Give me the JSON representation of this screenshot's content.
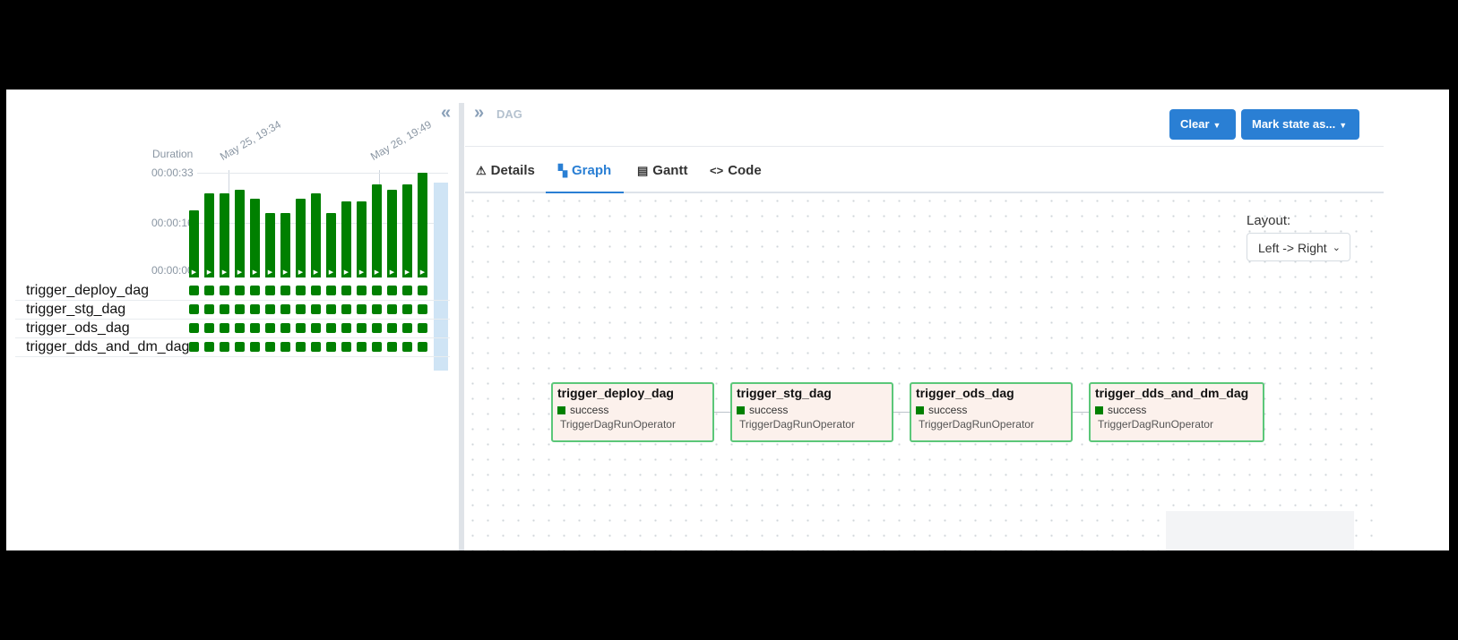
{
  "left_panel": {
    "collapse_icon": "double-chevron-left-icon",
    "duration_label": "Duration",
    "y_ticks": [
      "00:00:33",
      "00:00:16",
      "00:00:00"
    ],
    "date_labels": [
      "May 25, 19:34",
      "May 26, 19:49"
    ],
    "run_durations_sec": [
      20,
      26,
      26,
      27,
      24,
      19,
      19,
      24,
      26,
      19,
      23,
      23,
      29,
      27,
      29,
      33
    ],
    "run_state": "success",
    "tasks": [
      {
        "name": "trigger_deploy_dag"
      },
      {
        "name": "trigger_stg_dag"
      },
      {
        "name": "trigger_ods_dag"
      },
      {
        "name": "trigger_dds_and_dm_dag"
      }
    ]
  },
  "right_panel": {
    "expand_icon": "double-chevron-right-icon",
    "breadcrumb": "DAG",
    "buttons": {
      "clear_label": "Clear",
      "mark_state_label": "Mark state as..."
    },
    "tabs": [
      {
        "label": "Details",
        "icon": "warning-triangle-icon",
        "glyph": "⚠"
      },
      {
        "label": "Graph",
        "icon": "graph-icon",
        "glyph": "▚"
      },
      {
        "label": "Gantt",
        "icon": "gantt-icon",
        "glyph": "▤"
      },
      {
        "label": "Code",
        "icon": "code-icon",
        "glyph": "<>"
      }
    ],
    "active_tab": "Graph",
    "layout": {
      "label": "Layout:",
      "value": "Left -> Right"
    },
    "nodes": [
      {
        "title": "trigger_deploy_dag",
        "status": "success",
        "operator": "TriggerDagRunOperator"
      },
      {
        "title": "trigger_stg_dag",
        "status": "success",
        "operator": "TriggerDagRunOperator"
      },
      {
        "title": "trigger_ods_dag",
        "status": "success",
        "operator": "TriggerDagRunOperator"
      },
      {
        "title": "trigger_dds_and_dm_dag",
        "status": "success",
        "operator": "TriggerDagRunOperator"
      }
    ]
  },
  "colors": {
    "success": "#008000",
    "accent": "#2a7fd4",
    "node_fill": "#fcf1ec",
    "node_border": "#5bc779"
  }
}
